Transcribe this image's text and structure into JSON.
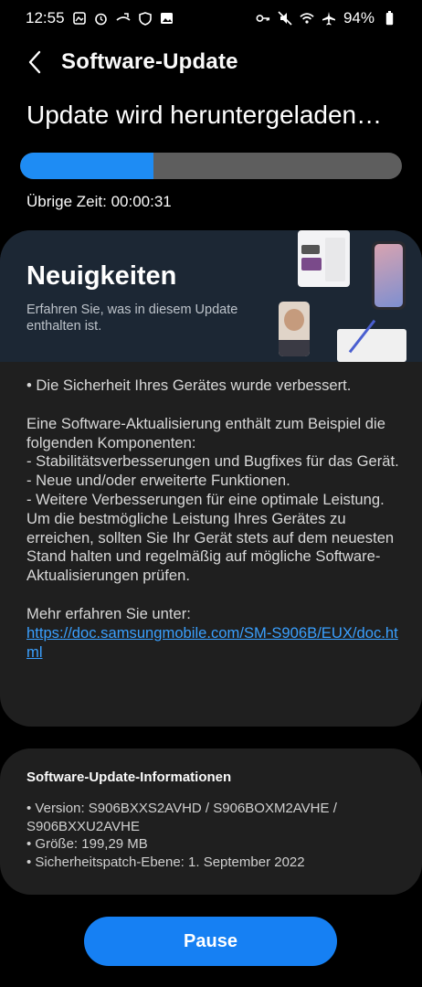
{
  "status_bar": {
    "time": "12:55",
    "battery": "94%",
    "left_icons": [
      "image-notification-icon",
      "alarm-icon",
      "call-forward-icon",
      "shield-icon",
      "gallery-icon"
    ],
    "right_icons": [
      "vpn-key-icon",
      "mute-icon",
      "wifi-icon",
      "airplane-icon",
      "battery-icon"
    ]
  },
  "app_bar": {
    "title": "Software-Update"
  },
  "download": {
    "heading": "Update wird heruntergeladen…",
    "progress_percent": 35,
    "remaining_label": "Übrige Zeit: 00:00:31"
  },
  "news": {
    "title": "Neuigkeiten",
    "subtitle": "Erfahren Sie, was in diesem Update enthalten ist.",
    "paragraphs": {
      "p1": "• Die Sicherheit Ihres Gerätes wurde verbessert.",
      "p2": "Eine Software-Aktualisierung enthält zum Beispiel die folgenden Komponenten:",
      "p3": " - Stabilitätsverbesserungen und Bugfixes für das Gerät.",
      "p4": " - Neue und/oder erweiterte Funktionen.",
      "p5": " - Weitere Verbesserungen für eine optimale Leistung.",
      "p6": "Um die bestmögliche Leistung Ihres Gerätes zu erreichen, sollten Sie Ihr Gerät stets auf dem neuesten Stand halten und regelmäßig auf mögliche Software-Aktualisierungen prüfen.",
      "p7": "Mehr erfahren Sie unter:",
      "link": "https://doc.samsungmobile.com/SM-S906B/EUX/doc.html"
    }
  },
  "info": {
    "title": "Software-Update-Informationen",
    "version": "• Version: S906BXXS2AVHD / S906BOXM2AVHE / S906BXXU2AVHE",
    "size": "• Größe: 199,29 MB",
    "patch": "• Sicherheitspatch-Ebene: 1. September 2022"
  },
  "pause_button": {
    "label": "Pause"
  },
  "colors": {
    "accent": "#1680f3",
    "progress": "#1e8cf4",
    "link": "#3aa0ff"
  }
}
